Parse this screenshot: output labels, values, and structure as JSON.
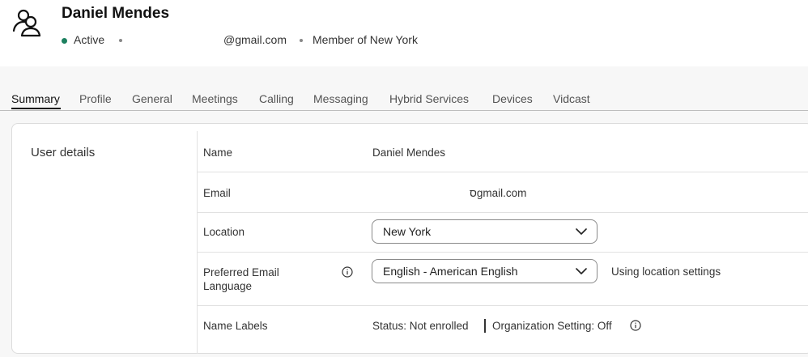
{
  "header": {
    "user_name": "Daniel Mendes",
    "status": "Active",
    "email": "@gmail.com",
    "membership": "Member of New York",
    "status_color": "#1d805f"
  },
  "tabs": [
    {
      "label": "Summary",
      "active": true
    },
    {
      "label": "Profile"
    },
    {
      "label": "General"
    },
    {
      "label": "Meetings"
    },
    {
      "label": "Calling"
    },
    {
      "label": "Messaging"
    },
    {
      "label": "Hybrid Services"
    },
    {
      "label": "Devices"
    },
    {
      "label": "Vidcast"
    }
  ],
  "user_details": {
    "section_title": "User details",
    "name_label": "Name",
    "name_value": "Daniel Mendes",
    "email_label": "Email",
    "email_value": "סgmail.com",
    "location_label": "Location",
    "location_value": "New York",
    "language_label_line1": "Preferred Email",
    "language_label_line2": "Language",
    "language_value": "English - American English",
    "language_note": "Using location settings",
    "name_labels_label": "Name Labels",
    "status_text": "Status:  Not enrolled",
    "org_setting_text": "Organization Setting:  Off"
  },
  "icons": {
    "user_icon": "people-icon",
    "dropdown": "chevron-down-icon",
    "info": "info-icon"
  }
}
